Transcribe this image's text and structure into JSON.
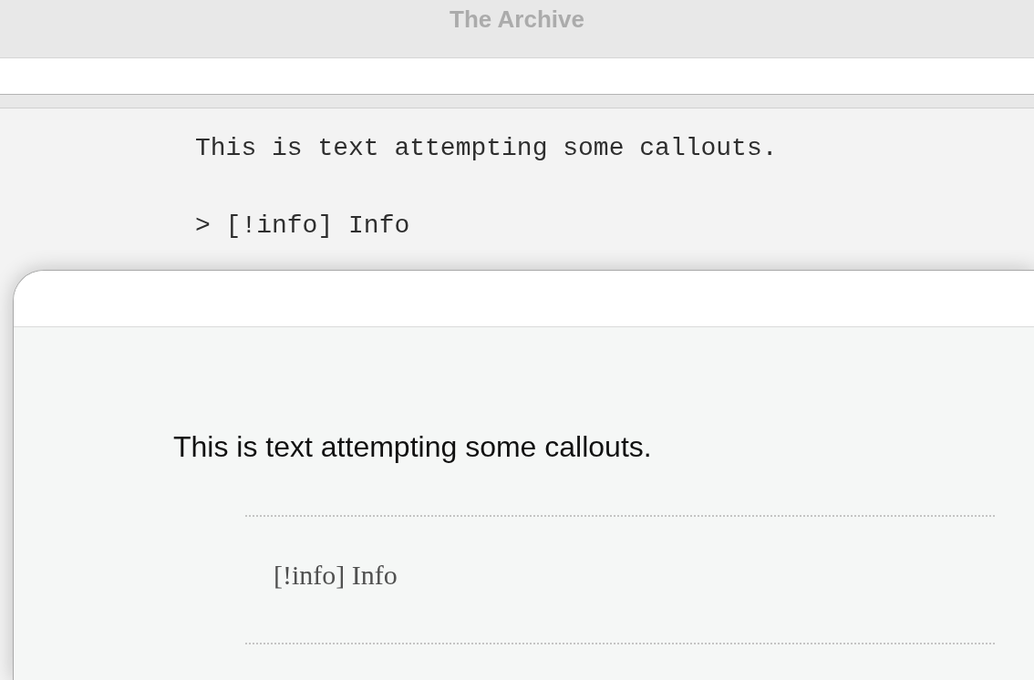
{
  "window": {
    "title": "The Archive"
  },
  "editor": {
    "lines": [
      "This is text attempting some callouts.",
      "> [!info] Info"
    ]
  },
  "preview": {
    "blocks": [
      {
        "kind": "paragraph",
        "text": "This is text attempting some callouts."
      },
      {
        "kind": "blockquote",
        "text": "[!info] Info"
      }
    ]
  }
}
